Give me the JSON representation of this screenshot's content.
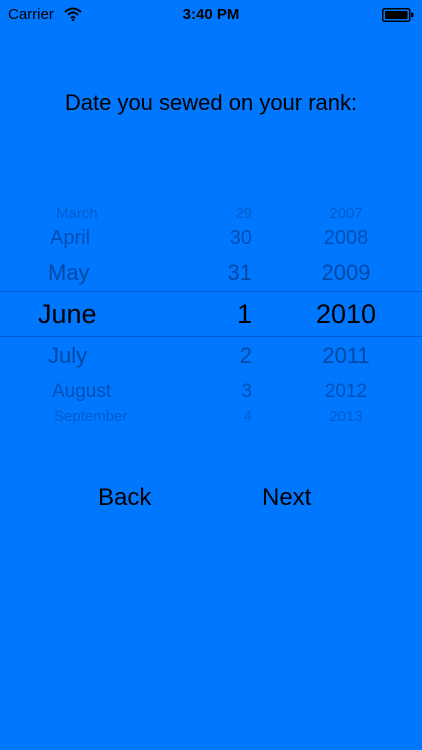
{
  "status_bar": {
    "carrier": "Carrier",
    "time": "3:40 PM",
    "wifi_icon": "wifi-icon",
    "battery_icon": "battery-icon"
  },
  "prompt": "Date you sewed on your rank:",
  "picker": {
    "months": [
      "March",
      "April",
      "May",
      "June",
      "July",
      "August",
      "September"
    ],
    "days": [
      "29",
      "30",
      "31",
      "1",
      "2",
      "3",
      "4"
    ],
    "years": [
      "2007",
      "2008",
      "2009",
      "2010",
      "2011",
      "2012",
      "2013"
    ],
    "selected": {
      "month": "June",
      "day": "1",
      "year": "2010"
    }
  },
  "buttons": {
    "back": "Back",
    "next": "Next"
  }
}
